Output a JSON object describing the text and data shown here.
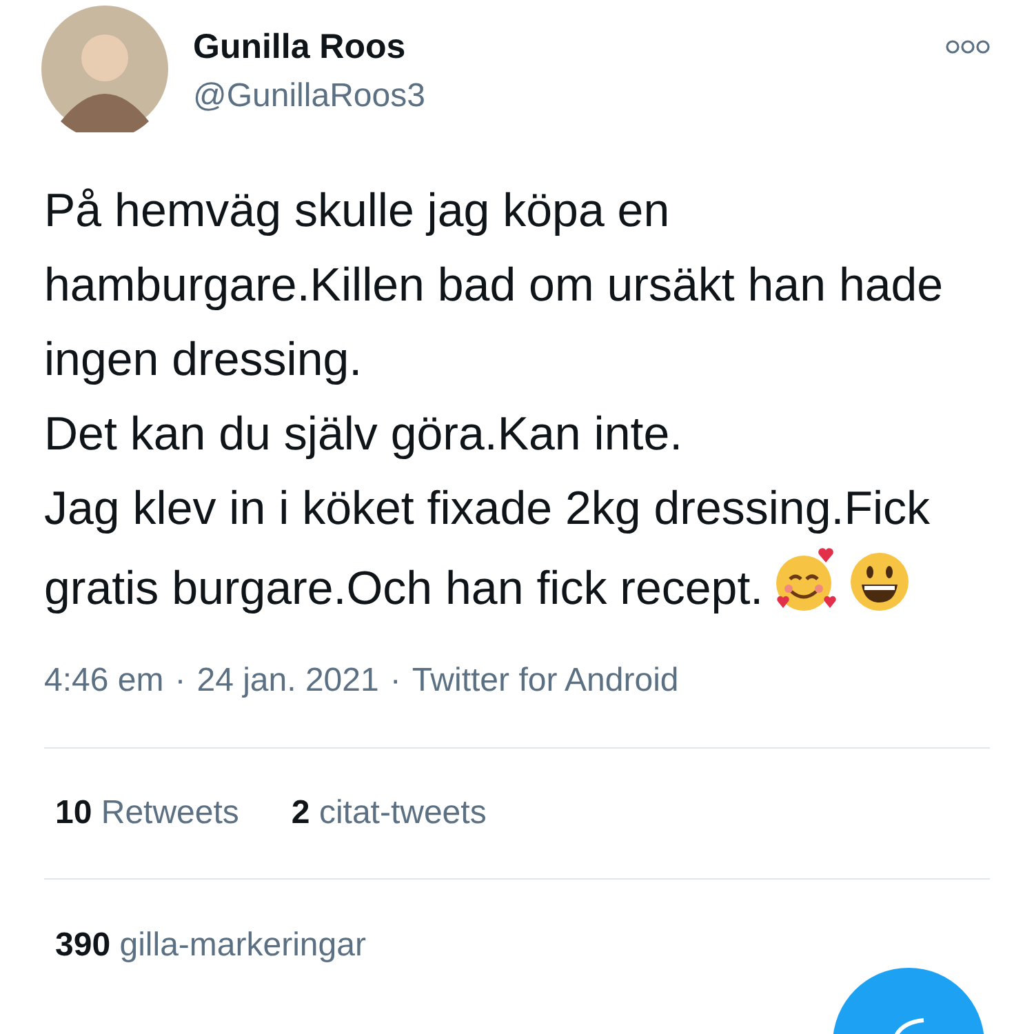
{
  "author": {
    "name": "Gunilla Roos",
    "handle": "@GunillaRoos3"
  },
  "tweet": {
    "paragraphs": [
      "På hemväg skulle jag köpa en hamburgare.Killen bad om ursäkt han hade ingen dressing.",
      "Det kan du själv göra.Kan inte.",
      "Jag klev in i köket fixade 2kg dressing.Fick gratis burgare.Och han fick recept."
    ]
  },
  "meta": {
    "separator": "·",
    "items": [
      "4:46 em",
      "24 jan. 2021",
      "Twitter for Android"
    ]
  },
  "stats": [
    {
      "count": "10",
      "label": "Retweets"
    },
    {
      "count": "2",
      "label": "citat-tweets"
    }
  ],
  "likes": {
    "count": "390",
    "label": "gilla-markeringar"
  }
}
